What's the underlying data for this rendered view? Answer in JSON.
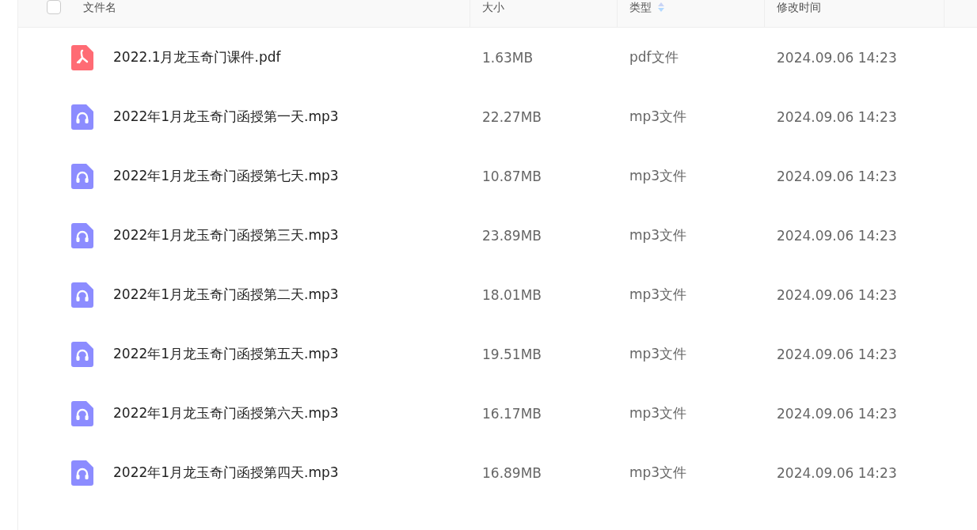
{
  "header": {
    "select_all": {
      "checked": false
    },
    "columns": [
      {
        "label": "文件名",
        "sortable": false
      },
      {
        "label": "大小",
        "sortable": false
      },
      {
        "label": "类型",
        "sortable": true
      },
      {
        "label": "修改时间",
        "sortable": false
      }
    ]
  },
  "files": [
    {
      "kind": "pdf",
      "name": "2022.1月龙玉奇门课件.pdf",
      "size": "1.63MB",
      "type": "pdf文件",
      "modified": "2024.09.06 14:23"
    },
    {
      "kind": "audio",
      "name": "2022年1月龙玉奇门函授第一天.mp3",
      "size": "22.27MB",
      "type": "mp3文件",
      "modified": "2024.09.06 14:23"
    },
    {
      "kind": "audio",
      "name": "2022年1月龙玉奇门函授第七天.mp3",
      "size": "10.87MB",
      "type": "mp3文件",
      "modified": "2024.09.06 14:23"
    },
    {
      "kind": "audio",
      "name": "2022年1月龙玉奇门函授第三天.mp3",
      "size": "23.89MB",
      "type": "mp3文件",
      "modified": "2024.09.06 14:23"
    },
    {
      "kind": "audio",
      "name": "2022年1月龙玉奇门函授第二天.mp3",
      "size": "18.01MB",
      "type": "mp3文件",
      "modified": "2024.09.06 14:23"
    },
    {
      "kind": "audio",
      "name": "2022年1月龙玉奇门函授第五天.mp3",
      "size": "19.51MB",
      "type": "mp3文件",
      "modified": "2024.09.06 14:23"
    },
    {
      "kind": "audio",
      "name": "2022年1月龙玉奇门函授第六天.mp3",
      "size": "16.17MB",
      "type": "mp3文件",
      "modified": "2024.09.06 14:23"
    },
    {
      "kind": "audio",
      "name": "2022年1月龙玉奇门函授第四天.mp3",
      "size": "16.89MB",
      "type": "mp3文件",
      "modified": "2024.09.06 14:23"
    }
  ]
}
